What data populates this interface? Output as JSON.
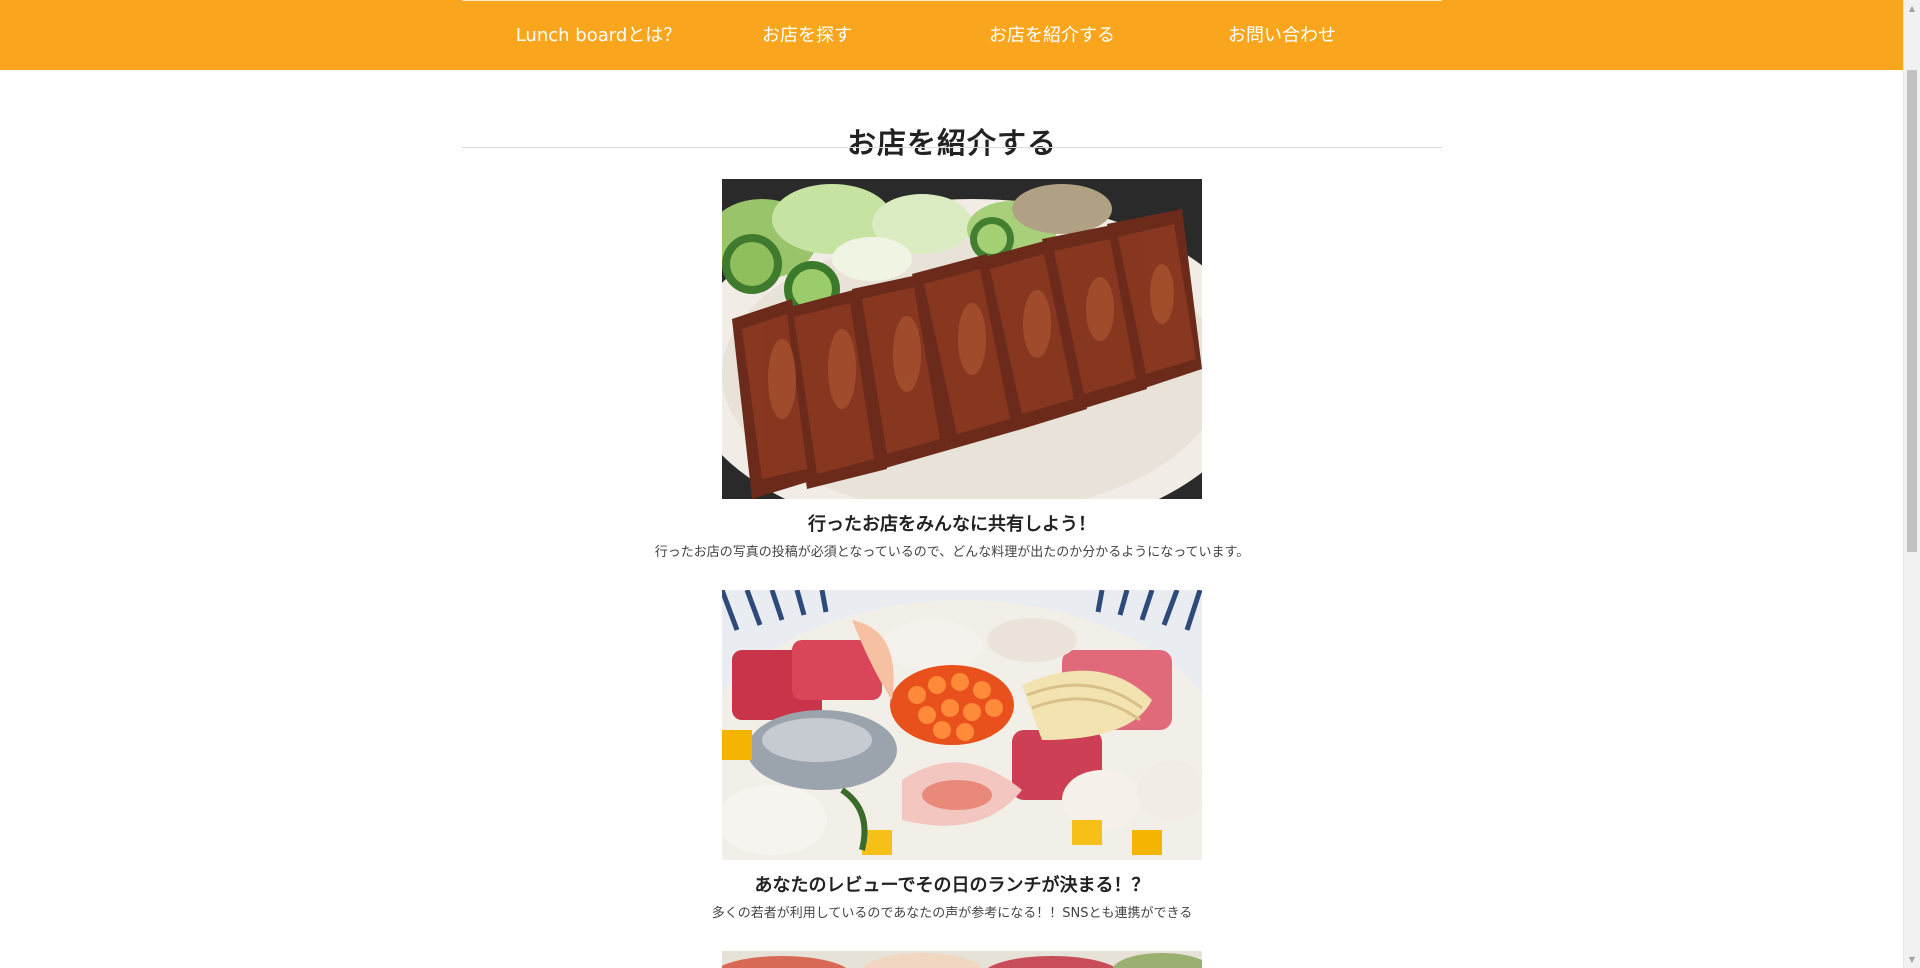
{
  "nav": {
    "items": [
      {
        "label": "Lunch boardとは？"
      },
      {
        "label": "お店を探す"
      },
      {
        "label": "お店を紹介する"
      },
      {
        "label": "お問い合わせ"
      }
    ]
  },
  "section": {
    "title": "お店を紹介する"
  },
  "features": [
    {
      "title": "行ったお店をみんなに共有しよう！",
      "description": "行ったお店の写真の投稿が必須となっているので、どんな料理が出たのか分かるようになっています。",
      "image": "grilled-beef-tongue-photo"
    },
    {
      "title": "あなたのレビューでその日のランチが決まる！？",
      "description": "多くの若者が利用しているのであなたの声が参考になる！！SNSとも連携ができる",
      "image": "kaisendon-seafood-bowl-photo"
    },
    {
      "image": "seafood-photo-partial"
    }
  ],
  "colors": {
    "nav_background": "#f9a61e",
    "nav_text": "#ffffff"
  },
  "scrollbar": {
    "up_icon": "scroll-up-arrow-icon",
    "down_icon": "scroll-down-arrow-icon"
  }
}
